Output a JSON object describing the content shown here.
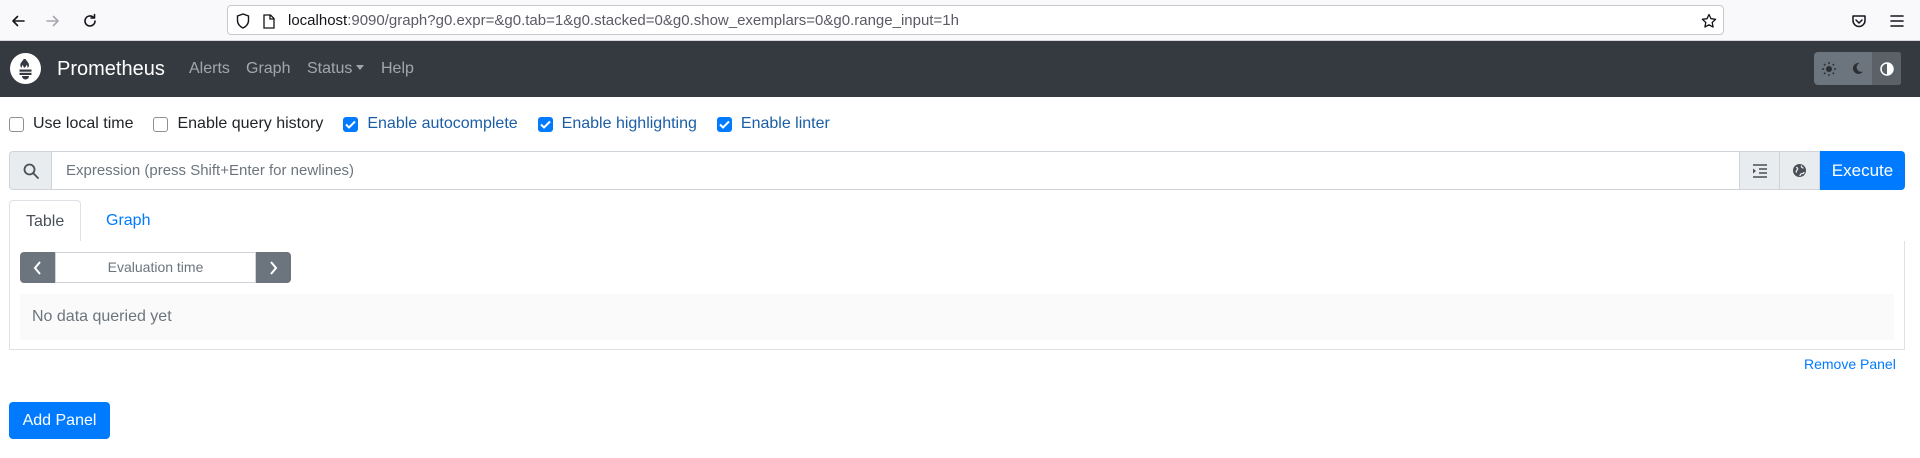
{
  "browser": {
    "url_host": "localhost",
    "url_rest": ":9090/graph?g0.expr=&g0.tab=1&g0.stacked=0&g0.show_exemplars=0&g0.range_input=1h"
  },
  "navbar": {
    "brand": "Prometheus",
    "links": {
      "alerts": "Alerts",
      "graph": "Graph",
      "status": "Status",
      "help": "Help"
    }
  },
  "options": {
    "use_local_time": {
      "label": "Use local time",
      "checked": false
    },
    "enable_query_history": {
      "label": "Enable query history",
      "checked": false
    },
    "enable_autocomplete": {
      "label": "Enable autocomplete",
      "checked": true
    },
    "enable_highlighting": {
      "label": "Enable highlighting",
      "checked": true
    },
    "enable_linter": {
      "label": "Enable linter",
      "checked": true
    }
  },
  "expression": {
    "placeholder": "Expression (press Shift+Enter for newlines)",
    "value": "",
    "execute_label": "Execute"
  },
  "tabs": {
    "table": "Table",
    "graph": "Graph"
  },
  "panel": {
    "eval_time_placeholder": "Evaluation time",
    "no_data": "No data queried yet",
    "remove_label": "Remove Panel"
  },
  "add_panel_label": "Add Panel",
  "colors": {
    "navbar_bg": "#343a40",
    "primary": "#007bff",
    "secondary": "#6c757d"
  }
}
